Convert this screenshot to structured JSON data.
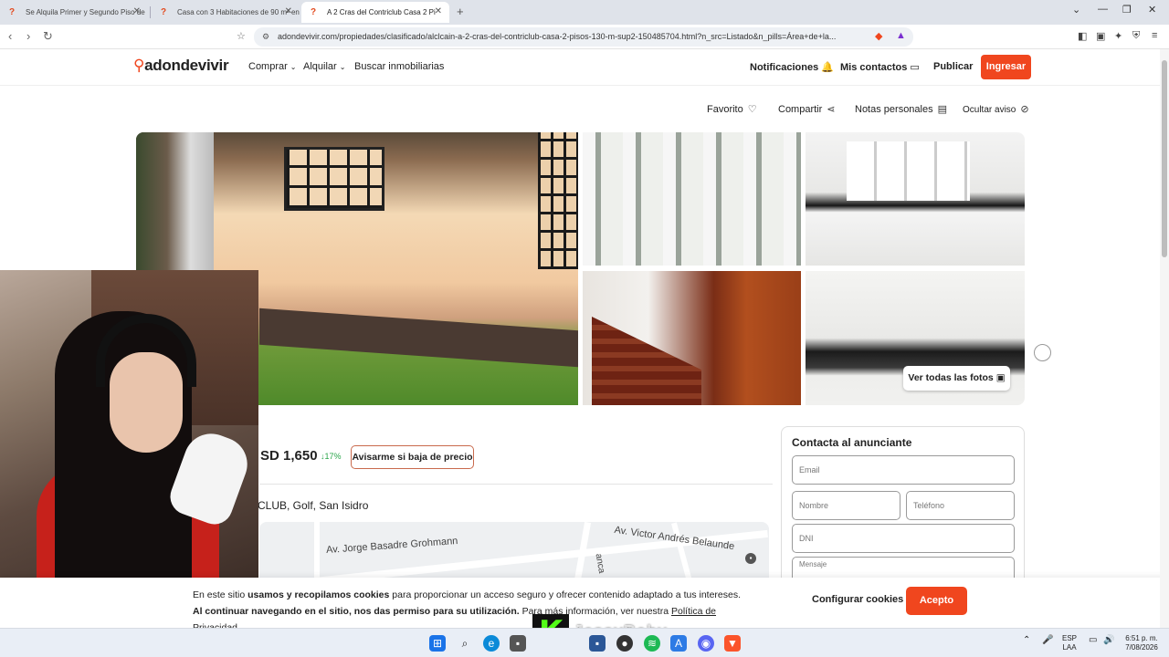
{
  "browser": {
    "tabs": [
      {
        "title": "Se Alquila Primer y Segundo Piso de"
      },
      {
        "title": "Casa con 3 Habitaciones de 90 m² en"
      },
      {
        "title": "A 2 Cras del Contriclub Casa 2 Pi"
      }
    ],
    "url": "adondevivir.com/propiedades/clasificado/alclcain-a-2-cras-del-contriclub-casa-2-pisos-130-m-sup2-150485704.html?n_src=Listado&n_pills=Área+de+la..."
  },
  "header": {
    "logo": "adondevivir",
    "nav": [
      {
        "label": "Comprar",
        "has_dropdown": true
      },
      {
        "label": "Alquilar",
        "has_dropdown": true
      },
      {
        "label": "Buscar inmobiliarias",
        "has_dropdown": false
      }
    ],
    "notifications": "Notificaciones",
    "contacts": "Mis contactos",
    "publish": "Publicar",
    "login": "Ingresar"
  },
  "actions": {
    "favorite": "Favorito",
    "share": "Compartir",
    "notes": "Notas personales",
    "hide": "Ocultar aviso"
  },
  "gallery": {
    "all_photos": "Ver todas las fotos"
  },
  "listing": {
    "price": "SD 1,650",
    "price_drop": "↓17%",
    "price_alert": "Avisarme si baja de precio",
    "address": "CLUB, Golf, San Isidro"
  },
  "map": {
    "streets": [
      "Av. Jorge Basadre Grohmann",
      "Av. Victor Andrés Belaunde",
      "anca"
    ]
  },
  "contact": {
    "title": "Contacta al anunciante",
    "email_placeholder": "Email",
    "name_placeholder": "Nombre",
    "phone_placeholder": "Teléfono",
    "dni_placeholder": "DNI",
    "message_placeholder": "Mensaje"
  },
  "cookie": {
    "text_1": "En este sitio ",
    "bold_1": "usamos y recopilamos cookies",
    "text_2": " para proporcionar un acceso seguro y ofrecer contenido adaptado a tus intereses. ",
    "bold_2": "Al continuar navegando en el sitio, nos das permiso para su utilización.",
    "text_3": " Para más información, ver nuestra ",
    "link": "Política de Privacidad.",
    "configure": "Configurar cookies",
    "accept": "Acepto"
  },
  "stream_overlay": {
    "badge": "K",
    "name": "JessyBaby"
  },
  "taskbar": {
    "lang_1": "ESP",
    "lang_2": "LAA",
    "time": "6:51 p. m.",
    "date": "7/08/2026"
  },
  "colors": {
    "brand": "#f0461e",
    "price_drop": "#2aa54a"
  }
}
